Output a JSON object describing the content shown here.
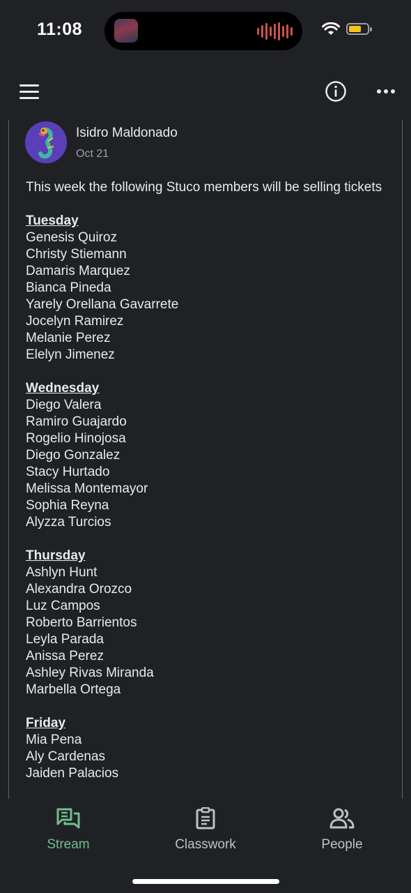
{
  "status_bar": {
    "time": "11:08",
    "icons": [
      "wifi-icon",
      "battery-icon"
    ],
    "battery_color": "#f5c518"
  },
  "app_bar": {
    "icons": [
      "menu-icon",
      "info-icon",
      "more-icon"
    ]
  },
  "post": {
    "author": "Isidro Maldonado",
    "date": "Oct 21",
    "intro": "This week the following Stuco members will be selling tickets",
    "days": [
      {
        "day": "Tuesday",
        "names": [
          "Genesis Quiroz",
          "Christy Stiemann",
          "Damaris Marquez",
          "Bianca Pineda",
          "Yarely Orellana Gavarrete",
          "Jocelyn Ramirez",
          "Melanie Perez",
          "Elelyn Jimenez"
        ]
      },
      {
        "day": "Wednesday",
        "names": [
          "Diego Valera",
          "Ramiro Guajardo",
          "Rogelio Hinojosa",
          "Diego Gonzalez",
          "Stacy Hurtado",
          "Melissa Montemayor",
          "Sophia Reyna",
          "Alyzza Turcios"
        ]
      },
      {
        "day": "Thursday",
        "names": [
          "Ashlyn Hunt",
          "Alexandra Orozco",
          "Luz Campos",
          "Roberto Barrientos",
          "Leyla Parada",
          "Anissa Perez",
          "Ashley Rivas Miranda",
          "Marbella Ortega"
        ]
      },
      {
        "day": "Friday",
        "names": [
          "Mia Pena",
          "Aly Cardenas",
          "Jaiden Palacios"
        ]
      }
    ]
  },
  "bottom_nav": {
    "active_color": "#6fbf8f",
    "items": [
      {
        "label": "Stream",
        "icon": "stream-icon",
        "active": true
      },
      {
        "label": "Classwork",
        "icon": "classwork-icon",
        "active": false
      },
      {
        "label": "People",
        "icon": "people-icon",
        "active": false
      }
    ]
  }
}
